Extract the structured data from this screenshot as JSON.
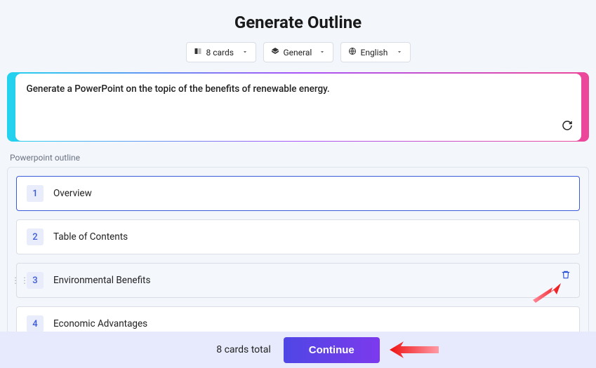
{
  "title": "Generate Outline",
  "selectors": {
    "cards": "8 cards",
    "category": "General",
    "language": "English"
  },
  "prompt": "Generate a PowerPoint on the topic of the benefits of renewable energy.",
  "section_label": "Powerpoint outline",
  "outline": [
    {
      "num": "1",
      "title": "Overview"
    },
    {
      "num": "2",
      "title": "Table of Contents"
    },
    {
      "num": "3",
      "title": "Environmental Benefits"
    },
    {
      "num": "4",
      "title": "Economic Advantages"
    }
  ],
  "footer": {
    "count_text": "8 cards total",
    "button": "Continue"
  }
}
